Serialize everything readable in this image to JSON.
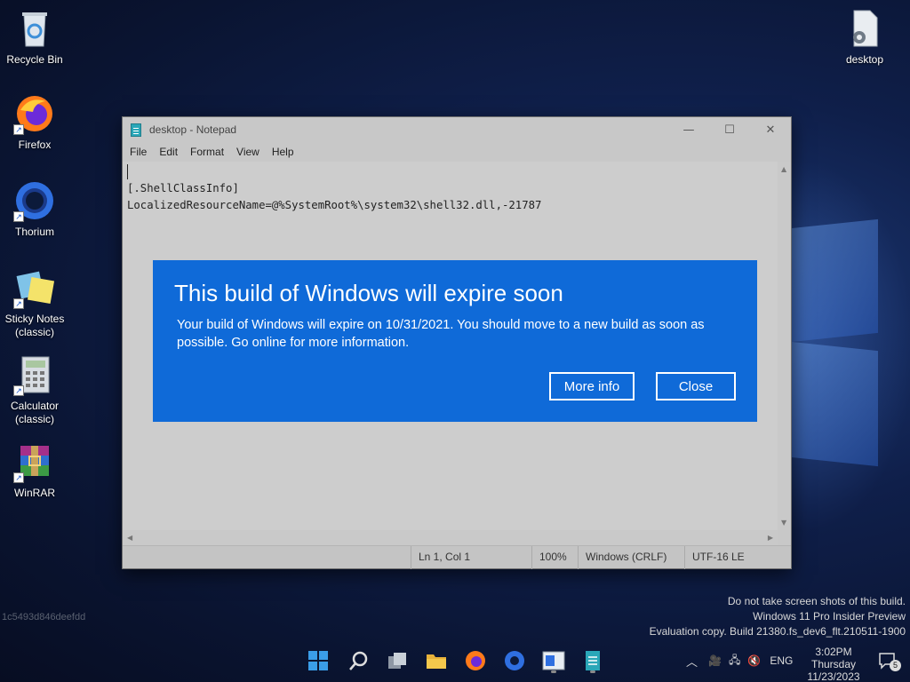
{
  "desktop": {
    "icons": [
      {
        "label": "Recycle Bin"
      },
      {
        "label": "Firefox"
      },
      {
        "label": "Thorium"
      },
      {
        "label": "Sticky Notes\n(classic)"
      },
      {
        "label": "Calculator\n(classic)"
      },
      {
        "label": "WinRAR"
      },
      {
        "label": "desktop"
      }
    ],
    "hash": "1c5493d846deefdd"
  },
  "notepad": {
    "title": "desktop - Notepad",
    "menu": [
      "File",
      "Edit",
      "Format",
      "View",
      "Help"
    ],
    "lines": [
      "",
      "[.ShellClassInfo]",
      "LocalizedResourceName=@%SystemRoot%\\system32\\shell32.dll,-21787"
    ],
    "status": {
      "position": "Ln 1, Col 1",
      "zoom": "100%",
      "line_ending": "Windows (CRLF)",
      "encoding": "UTF-16 LE"
    }
  },
  "dialog": {
    "title": "This build of Windows will expire soon",
    "body": "Your build of Windows will expire on 10/31/2021. You should move to a new build as soon as possible. Go online for more information.",
    "more_info": "More info",
    "close": "Close",
    "color": "#0f6ad8"
  },
  "watermark": {
    "line1": "Do not take screen shots of this build.",
    "line2": "Windows 11 Pro Insider Preview",
    "line3": "Evaluation copy. Build 21380.fs_dev6_flt.210511-1900"
  },
  "taskbar": {
    "language": "ENG",
    "time": "3:02PM",
    "day": "Thursday",
    "date": "11/23/2023",
    "notifications": "5"
  }
}
